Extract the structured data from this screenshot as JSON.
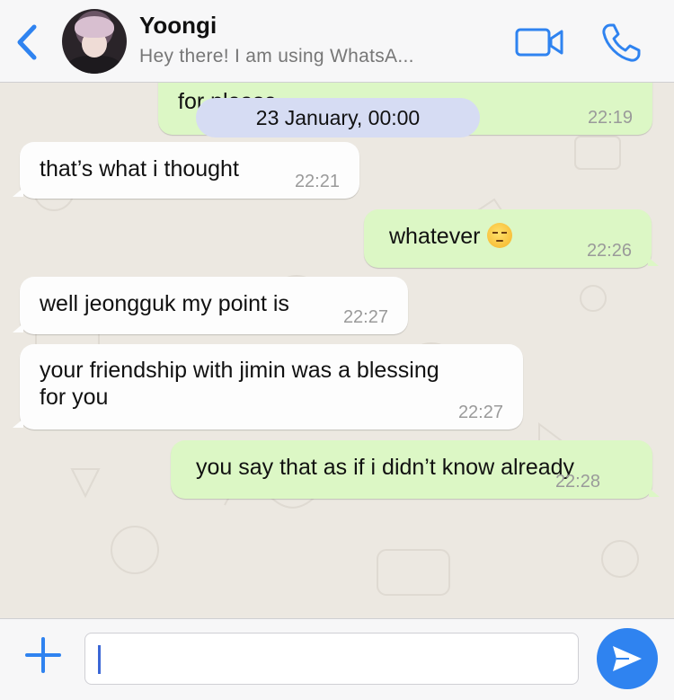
{
  "header": {
    "contact_name": "Yoongi",
    "contact_status": "Hey there! I am using WhatsA..."
  },
  "chat": {
    "date_separator": "23 January, 00:00",
    "partial_message": {
      "text": "for please",
      "time": "22:19"
    },
    "messages": [
      {
        "direction": "in",
        "text": "that’s what i thought",
        "time": "22:21"
      },
      {
        "direction": "out",
        "text": "whatever",
        "emoji": "unamused-face",
        "time": "22:26"
      },
      {
        "direction": "in",
        "text": "well jeongguk my point is",
        "time": "22:27"
      },
      {
        "direction": "in",
        "line1": "your friendship with jimin was a blessing",
        "line2": "for you",
        "time": "22:27"
      },
      {
        "direction": "out",
        "text": "you say that as if i didn’t know already",
        "time": "22:28"
      }
    ]
  },
  "composer": {
    "input_value": "",
    "input_placeholder": ""
  },
  "colors": {
    "accent": "#2f83f0",
    "outgoing_bubble": "#dcf7c5",
    "incoming_bubble": "#fdfdfd",
    "date_pill": "#d6dcf3",
    "wallpaper": "#ece8e1"
  },
  "icons": [
    "back-chevron-icon",
    "video-call-icon",
    "phone-call-icon",
    "plus-icon",
    "send-icon"
  ]
}
